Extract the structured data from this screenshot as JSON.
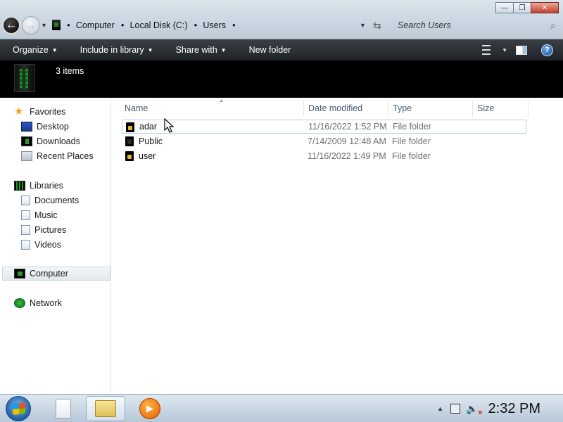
{
  "window": {
    "controls": {
      "minimize": "—",
      "maximize": "❐",
      "close": "✕"
    }
  },
  "nav": {
    "back_icon": "back-arrow-icon",
    "forward_icon": "forward-arrow-icon"
  },
  "address": {
    "breadcrumbs": [
      "Computer",
      "Local Disk (C:)",
      "Users"
    ]
  },
  "search": {
    "placeholder": "Search Users"
  },
  "toolbar": {
    "organize": "Organize",
    "include_in_library": "Include in library",
    "share_with": "Share with",
    "new_folder": "New folder"
  },
  "banner": {
    "items_count": "3 items"
  },
  "sidebar": {
    "favorites_label": "Favorites",
    "favorites": [
      "Desktop",
      "Downloads",
      "Recent Places"
    ],
    "libraries_label": "Libraries",
    "libraries": [
      "Documents",
      "Music",
      "Pictures",
      "Videos"
    ],
    "computer_label": "Computer",
    "network_label": "Network"
  },
  "columns": {
    "name": "Name",
    "date_modified": "Date modified",
    "type": "Type",
    "size": "Size"
  },
  "files": [
    {
      "name": "adar",
      "date": "11/16/2022 1:52 PM",
      "type": "File folder"
    },
    {
      "name": "Public",
      "date": "7/14/2009 12:48 AM",
      "type": "File folder"
    },
    {
      "name": "user",
      "date": "11/16/2022 1:49 PM",
      "type": "File folder"
    }
  ],
  "taskbar": {
    "clock": "2:32 PM"
  },
  "colors": {
    "command_bar": "#2c3035",
    "banner": "#000000",
    "accent_green": "#1f9a1f"
  }
}
